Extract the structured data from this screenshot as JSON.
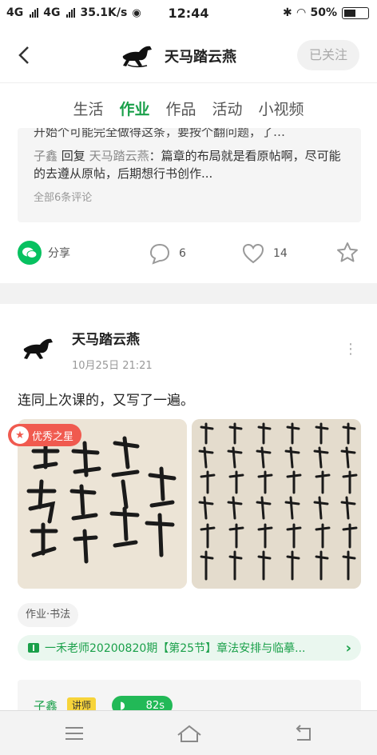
{
  "status": {
    "network1": "4G",
    "network2": "4G",
    "speed": "35.1K/s",
    "time": "12:44",
    "battery": "50%"
  },
  "header": {
    "title": "天马踏云燕",
    "follow_label": "已关注"
  },
  "tabs": [
    "生活",
    "作业",
    "作品",
    "活动",
    "小视频"
  ],
  "active_tab": "作业",
  "prev_post": {
    "cut_text": "开始个可能完全做得这条，要按个翻问题，了…",
    "reply_user": "子鑫",
    "reply_word": "回复",
    "reply_to": "天马踏云燕",
    "reply_text": "：篇章的布局就是看原帖啊，尽可能的去遵从原帖，后期想行书创作...",
    "all_comments": "全部6条评论",
    "share_label": "分享",
    "comment_count": "6",
    "like_count": "14"
  },
  "post": {
    "author": "天马踏云燕",
    "time": "10月25日  21:21",
    "text": "连同上次课的，又写了一遍。",
    "badge": "优秀之星",
    "tag": "作业·书法",
    "course": "一禾老师20200820期【第25节】章法安排与临摹...",
    "teacher_name": "子鑫",
    "teacher_tag": "讲师",
    "voice_length": "82s"
  },
  "colors": {
    "accent": "#1aa04a",
    "badge": "#f05a4f",
    "teacher_tag": "#f7d43a"
  }
}
